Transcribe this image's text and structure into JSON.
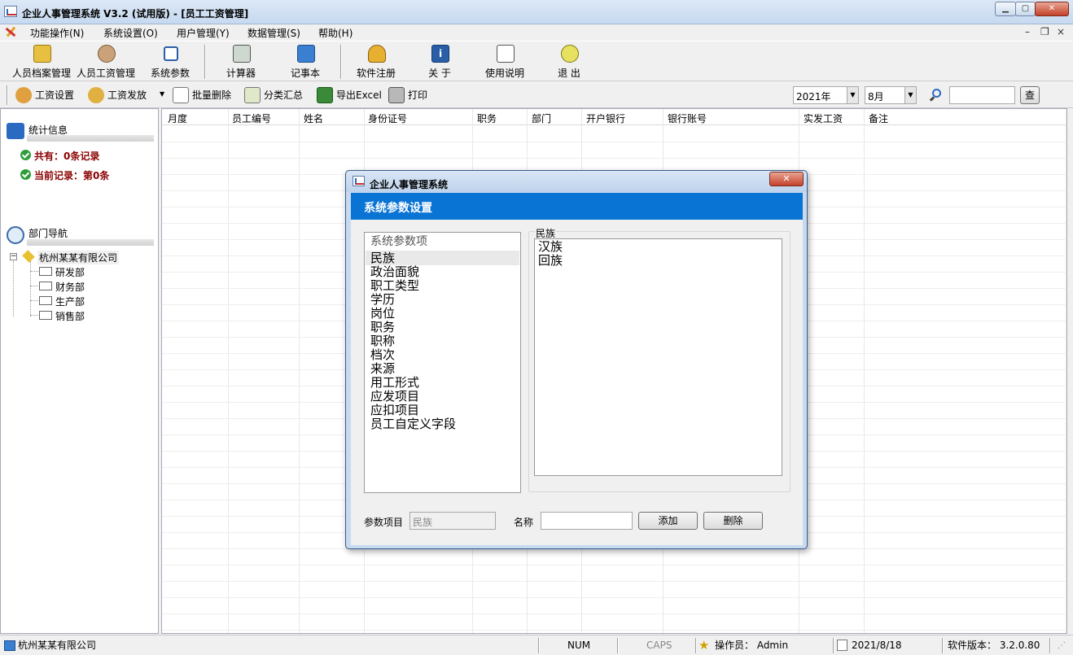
{
  "window": {
    "title": "企业人事管理系统 V3.2 (试用版) - [员工工资管理]"
  },
  "menu": {
    "items": [
      "功能操作(N)",
      "系统设置(O)",
      "用户管理(Y)",
      "数据管理(S)",
      "帮助(H)"
    ]
  },
  "toolbar": {
    "buttons": [
      "人员档案管理",
      "人员工资管理",
      "系统参数",
      "计算器",
      "记事本",
      "软件注册",
      "关 于",
      "使用说明",
      "退 出"
    ]
  },
  "toolbar2": {
    "buttons": [
      "工资设置",
      "工资发放",
      "批量删除",
      "分类汇总",
      "导出Excel",
      "打印"
    ],
    "year": "2021年",
    "month": "8月",
    "search_placeholder": "",
    "search_button": "查"
  },
  "left_panel": {
    "stats_title": "统计信息",
    "total": "共有：0条记录",
    "current": "当前记录：第0条",
    "nav_title": "部门导航",
    "company": "杭州某某有限公司",
    "departments": [
      "研发部",
      "财务部",
      "生产部",
      "销售部"
    ]
  },
  "grid": {
    "columns": [
      "月度",
      "员工编号",
      "姓名",
      "身份证号",
      "职务",
      "部门",
      "开户银行",
      "银行账号",
      "实发工资",
      "备注"
    ]
  },
  "dialog": {
    "title": "企业人事管理系统",
    "banner": "系统参数设置",
    "param_list_header": "系统参数项",
    "param_items": [
      "民族",
      "政治面貌",
      "职工类型",
      "学历",
      "岗位",
      "职务",
      "职称",
      "档次",
      "来源",
      "用工形式",
      "应发项目",
      "应扣项目",
      "员工自定义字段"
    ],
    "selected_param": "民族",
    "group_label": "民族",
    "values": [
      "汉族",
      "回族"
    ],
    "param_label": "参数项目",
    "param_value": "民族",
    "name_label": "名称",
    "name_value": "",
    "add_button": "添加",
    "delete_button": "删除"
  },
  "statusbar": {
    "company": "杭州某某有限公司",
    "num": "NUM",
    "caps": "CAPS",
    "operator": "操作员：  Admin",
    "date": "2021/8/18",
    "version": "软件版本：  3.2.0.80"
  },
  "colors": {
    "banner": "#0a74d4",
    "stat_text": "#8b0000",
    "dialog_frame": "#c8daf0"
  }
}
